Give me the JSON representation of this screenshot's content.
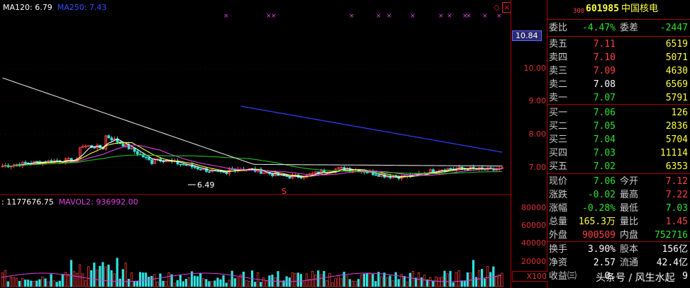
{
  "legend": {
    "ma120": "MA120: 6.79",
    "ma250": "MA250: 7.43",
    "vol": ": 1177676.75",
    "mavol2": "MAVOL2: 936992.00"
  },
  "price_marker": "10.84",
  "low_marker": "6.49",
  "price_axis": [
    "10.00",
    "9.00",
    "8.00",
    "7.00"
  ],
  "volume_axis": [
    "80000",
    "60000",
    "40000",
    "20000"
  ],
  "volume_unit": "X100",
  "stock": {
    "prefix": "300",
    "code": "601985",
    "name": "中国核电"
  },
  "weibi": {
    "label": "委比",
    "value": "-4.47%",
    "label2": "委差",
    "value2": "-2447"
  },
  "sell": [
    {
      "label": "卖五",
      "price": "7.11",
      "vol": "6519"
    },
    {
      "label": "卖四",
      "price": "7.10",
      "vol": "5071"
    },
    {
      "label": "卖三",
      "price": "7.09",
      "vol": "4630"
    },
    {
      "label": "卖二",
      "price": "7.08",
      "vol": "6569"
    },
    {
      "label": "卖一",
      "price": "7.07",
      "vol": "5791"
    }
  ],
  "buy": [
    {
      "label": "买一",
      "price": "7.06",
      "vol": "126"
    },
    {
      "label": "买二",
      "price": "7.05",
      "vol": "2836"
    },
    {
      "label": "买三",
      "price": "7.04",
      "vol": "5704"
    },
    {
      "label": "买四",
      "price": "7.03",
      "vol": "11114"
    },
    {
      "label": "买五",
      "price": "7.02",
      "vol": "6353"
    }
  ],
  "stats": [
    {
      "l1": "现价",
      "v1": "7.06",
      "c1": "green",
      "l2": "今开",
      "v2": "7.12",
      "c2": "red"
    },
    {
      "l1": "涨跌",
      "v1": "-0.02",
      "c1": "green",
      "l2": "最高",
      "v2": "7.22",
      "c2": "red"
    },
    {
      "l1": "涨幅",
      "v1": "-0.28%",
      "c1": "green",
      "l2": "最低",
      "v2": "7.03",
      "c2": "green"
    },
    {
      "l1": "总量",
      "v1": "165.3万",
      "c1": "yellow",
      "l2": "量比",
      "v2": "1.45",
      "c2": "red"
    },
    {
      "l1": "外盘",
      "v1": "900509",
      "c1": "red",
      "l2": "内盘",
      "v2": "752716",
      "c2": "green"
    }
  ],
  "extra": [
    {
      "l1": "换手",
      "v1": "3.90%",
      "l2": "股本",
      "v2": "156亿"
    },
    {
      "l1": "净资",
      "v1": "2.57",
      "l2": "流通",
      "v2": "42.4亿"
    },
    {
      "l1": "收益㈢",
      "v1": "0.",
      "l2": "",
      "v2": "9"
    }
  ],
  "watermark": "头条号 / 风生水起",
  "colors": {
    "up": "#ff4040",
    "down": "#30e030",
    "ma120": "#ffffff",
    "ma250": "#3040ff",
    "ma_purple": "#e040e0",
    "ma_green": "#20c020"
  }
}
